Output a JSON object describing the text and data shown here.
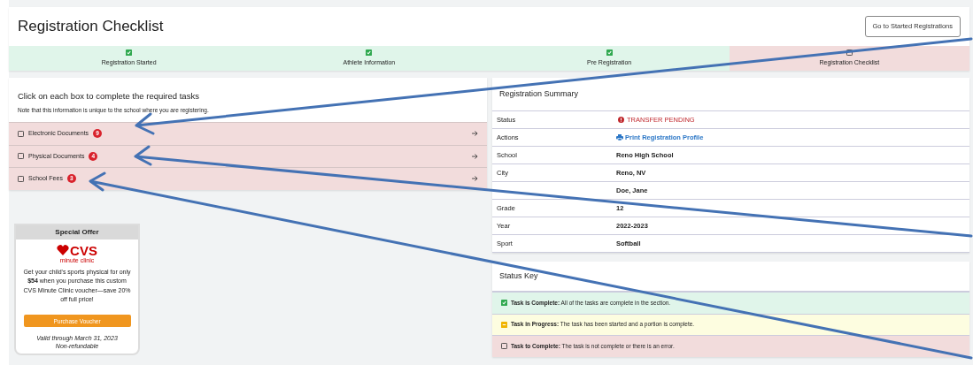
{
  "page": {
    "title": "Registration Checklist",
    "button": "Go to Started Registrations"
  },
  "steps": [
    {
      "label": "Registration Started",
      "complete": true
    },
    {
      "label": "Athlete Information",
      "complete": true
    },
    {
      "label": "Pre Registration",
      "complete": true
    },
    {
      "label": "Registration Checklist",
      "complete": false
    }
  ],
  "tasks": {
    "heading": "Click on each box to complete the required tasks",
    "note": "Note that this information is unique to the school where you are registering.",
    "items": [
      {
        "label": "Electronic Documents",
        "count": "9",
        "complete": false
      },
      {
        "label": "Physical Documents",
        "count": "4",
        "complete": false
      },
      {
        "label": "School Fees",
        "count": "3",
        "complete": false
      }
    ]
  },
  "offer": {
    "title": "Special Offer",
    "brand": "CVS",
    "brand_sub": "minute clinic",
    "text": "Get your child's sports physical for only **$54** when you purchase this custom CVS Minute Clinic voucher—save 20% off full price!",
    "button": "Purchase Voucher",
    "valid": "Valid through March 31, 2023",
    "terms": "Non-refundable"
  },
  "summary": {
    "title": "Registration Summary",
    "rows": [
      {
        "label": "Status",
        "value": "TRANSFER PENDING",
        "kind": "alert"
      },
      {
        "label": "Actions",
        "value": "Print Registration Profile",
        "kind": "link"
      },
      {
        "label": "School",
        "value": "Reno High School",
        "kind": "text"
      },
      {
        "label": "City",
        "value": "Reno, NV",
        "kind": "text"
      },
      {
        "value": "Doe, Jane",
        "kind": "text"
      },
      {
        "label": "Grade",
        "value": "12",
        "kind": "text"
      },
      {
        "label": "Year",
        "value": "2022-2023",
        "kind": "text"
      },
      {
        "label": "Sport",
        "value": "Softball",
        "kind": "text"
      }
    ]
  },
  "status_key": {
    "title": "Status Key",
    "items": [
      {
        "kind": "complete",
        "text": "**Task is Complete:** All of the tasks are complete in the section."
      },
      {
        "kind": "progress",
        "text": "**Task in Progress:** The task has been started and a portion is complete."
      },
      {
        "kind": "todo",
        "text": "**Task to Complete:** The task is not complete or there is an error."
      }
    ]
  }
}
